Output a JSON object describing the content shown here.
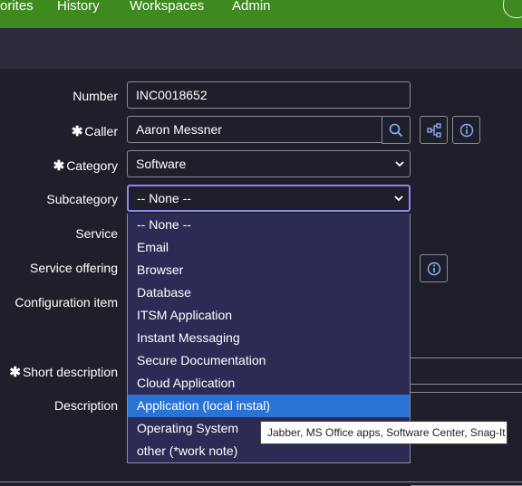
{
  "nav": {
    "items": [
      "orites",
      "History",
      "Workspaces",
      "Admin"
    ]
  },
  "form": {
    "number": {
      "label": "Number",
      "value": "INC0018652"
    },
    "caller": {
      "label": "Caller",
      "required": "✱",
      "value": "Aaron Messner"
    },
    "category": {
      "label": "Category",
      "required": "✱",
      "value": "Software"
    },
    "subcategory": {
      "label": "Subcategory",
      "value": "-- None --"
    },
    "service": {
      "label": "Service"
    },
    "service_offering": {
      "label": "Service offering"
    },
    "configuration_item": {
      "label": "Configuration item"
    },
    "short_description": {
      "label": "Short description",
      "required": "✱"
    },
    "description": {
      "label": "Description"
    }
  },
  "dropdown": {
    "options": [
      "-- None --",
      "Email",
      "Browser",
      "Database",
      "ITSM Application",
      "Instant Messaging",
      "Secure Documentation",
      "Cloud Application",
      "Application (local instal)",
      "Operating System",
      "other (*work note)"
    ],
    "highlighted": "Application (local instal)"
  },
  "tooltip": {
    "text": "Jabber, MS Office apps, Software Center, Snag-It"
  },
  "colors": {
    "nav_bg": "#3f8a1f",
    "page_bg": "#1f1f2c",
    "dropdown_bg": "#2b2b55",
    "highlight": "#2a72d4",
    "focus_border": "#8a88f5"
  }
}
